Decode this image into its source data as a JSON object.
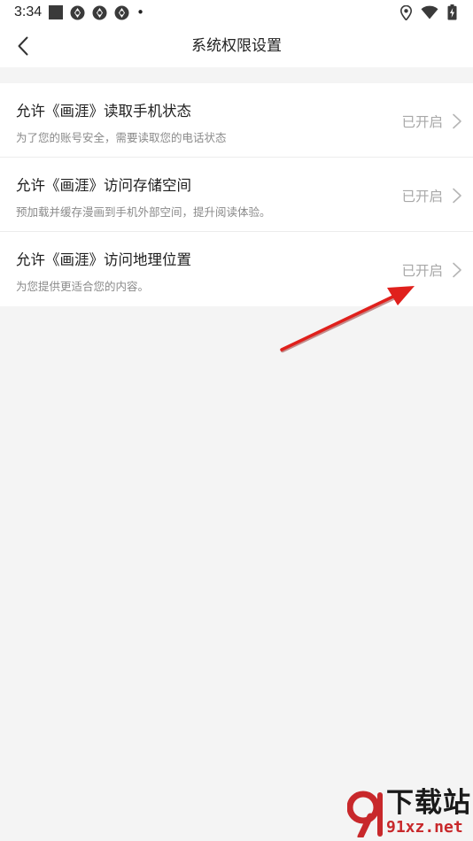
{
  "status_bar": {
    "time": "3:34",
    "dot": "•",
    "icons": [
      "stop-square-icon",
      "aperture-icon",
      "aperture-icon",
      "aperture-icon",
      "location-pin-icon",
      "wifi-icon",
      "battery-charging-icon"
    ]
  },
  "nav": {
    "title": "系统权限设置",
    "back_icon": "chevron-left-icon"
  },
  "permissions": [
    {
      "title": "允许《画涯》读取手机状态",
      "description": "为了您的账号安全，需要读取您的电话状态",
      "status": "已开启"
    },
    {
      "title": "允许《画涯》访问存储空间",
      "description": "预加载并缓存漫画到手机外部空间，提升阅读体验。",
      "status": "已开启"
    },
    {
      "title": "允许《画涯》访问地理位置",
      "description": "为您提供更适合您的内容。",
      "status": "已开启"
    }
  ],
  "watermark": {
    "brand": "下载站",
    "url": "91xz.net"
  },
  "colors": {
    "background": "#f4f4f4",
    "card": "#ffffff",
    "status_text": "#a8a8a8",
    "annotation_arrow": "#e0201c",
    "watermark_red": "#c8282b"
  }
}
